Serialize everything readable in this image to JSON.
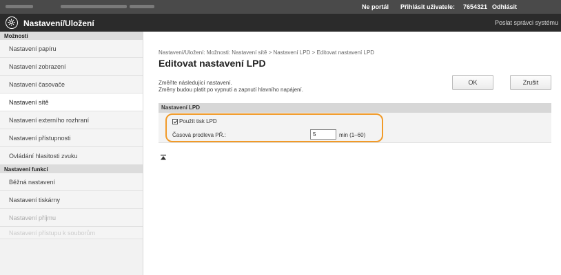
{
  "topbar": {
    "portal_link": "Ne portál",
    "user_label": "Přihlásit uživatele:",
    "user_id": "7654321",
    "logout_link": "Odhlásit"
  },
  "titlebar": {
    "title": "Nastavení/Uložení",
    "admin_mail": "Poslat správci systému"
  },
  "sidebar": {
    "section1": "Možnosti",
    "items1": [
      "Nastavení papíru",
      "Nastavení zobrazení",
      "Nastavení časovače",
      "Nastavení sítě",
      "Nastavení externího rozhraní",
      "Nastavení přístupnosti",
      "Ovládání hlasitosti zvuku"
    ],
    "section2": "Nastavení funkcí",
    "items2": [
      "Běžná nastavení",
      "Nastavení tiskárny",
      "Nastavení příjmu",
      "Nastavení přístupu k souborům"
    ]
  },
  "main": {
    "breadcrumb": "Nastavení/Uložení: Možnosti: Nastavení sítě > Nastavení LPD > Editovat nastavení LPD",
    "title": "Editovat nastavení LPD",
    "desc1": "Změňte následující nastavení.",
    "desc2": "Změny budou platit po vypnutí a zapnutí hlavního napájení.",
    "ok": "OK",
    "cancel": "Zrušit",
    "panel_header": "Nastavení LPD",
    "use_lpd_label": "Použít tisk LPD",
    "timeout_label": "Časová prodleva PŘ.:",
    "timeout_value": "5",
    "timeout_unit": "min (1–60)"
  },
  "colors": {
    "highlight": "#f19a28",
    "topbar": "#4a4a4a",
    "titlebar": "#2b2b2b"
  },
  "icons": {
    "logo": "settings-logo-icon",
    "back_to_top": "triangle-up-icon"
  }
}
